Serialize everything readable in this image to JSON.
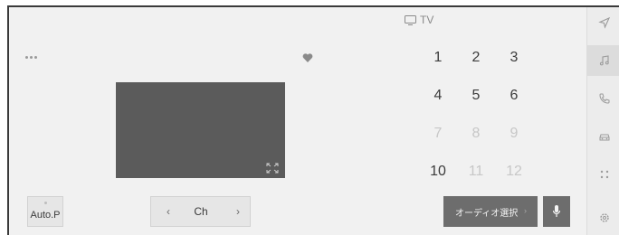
{
  "source": {
    "icon": "tv-icon",
    "label": "TV"
  },
  "keypad": {
    "keys": [
      "1",
      "2",
      "3",
      "4",
      "5",
      "6",
      "7",
      "8",
      "9",
      "10",
      "11",
      "12"
    ]
  },
  "bottom": {
    "auto_p": "Auto.P",
    "channel_prev": "‹",
    "channel_label": "Ch",
    "channel_next": "›",
    "audio_select": "オーディオ選択",
    "audio_select_chevron": "›"
  },
  "sidebar": {
    "items": [
      {
        "icon": "navigation-icon",
        "active": false
      },
      {
        "icon": "music-note-icon",
        "active": true
      },
      {
        "icon": "phone-icon",
        "active": false
      },
      {
        "icon": "car-icon",
        "active": false
      },
      {
        "icon": "apps-grid-icon",
        "active": false
      },
      {
        "icon": "gear-icon",
        "active": false
      }
    ]
  },
  "colors": {
    "screen_bg": "#f1f1f1",
    "video_bg": "#5b5b5b",
    "button_dark": "#6d6d6d"
  }
}
